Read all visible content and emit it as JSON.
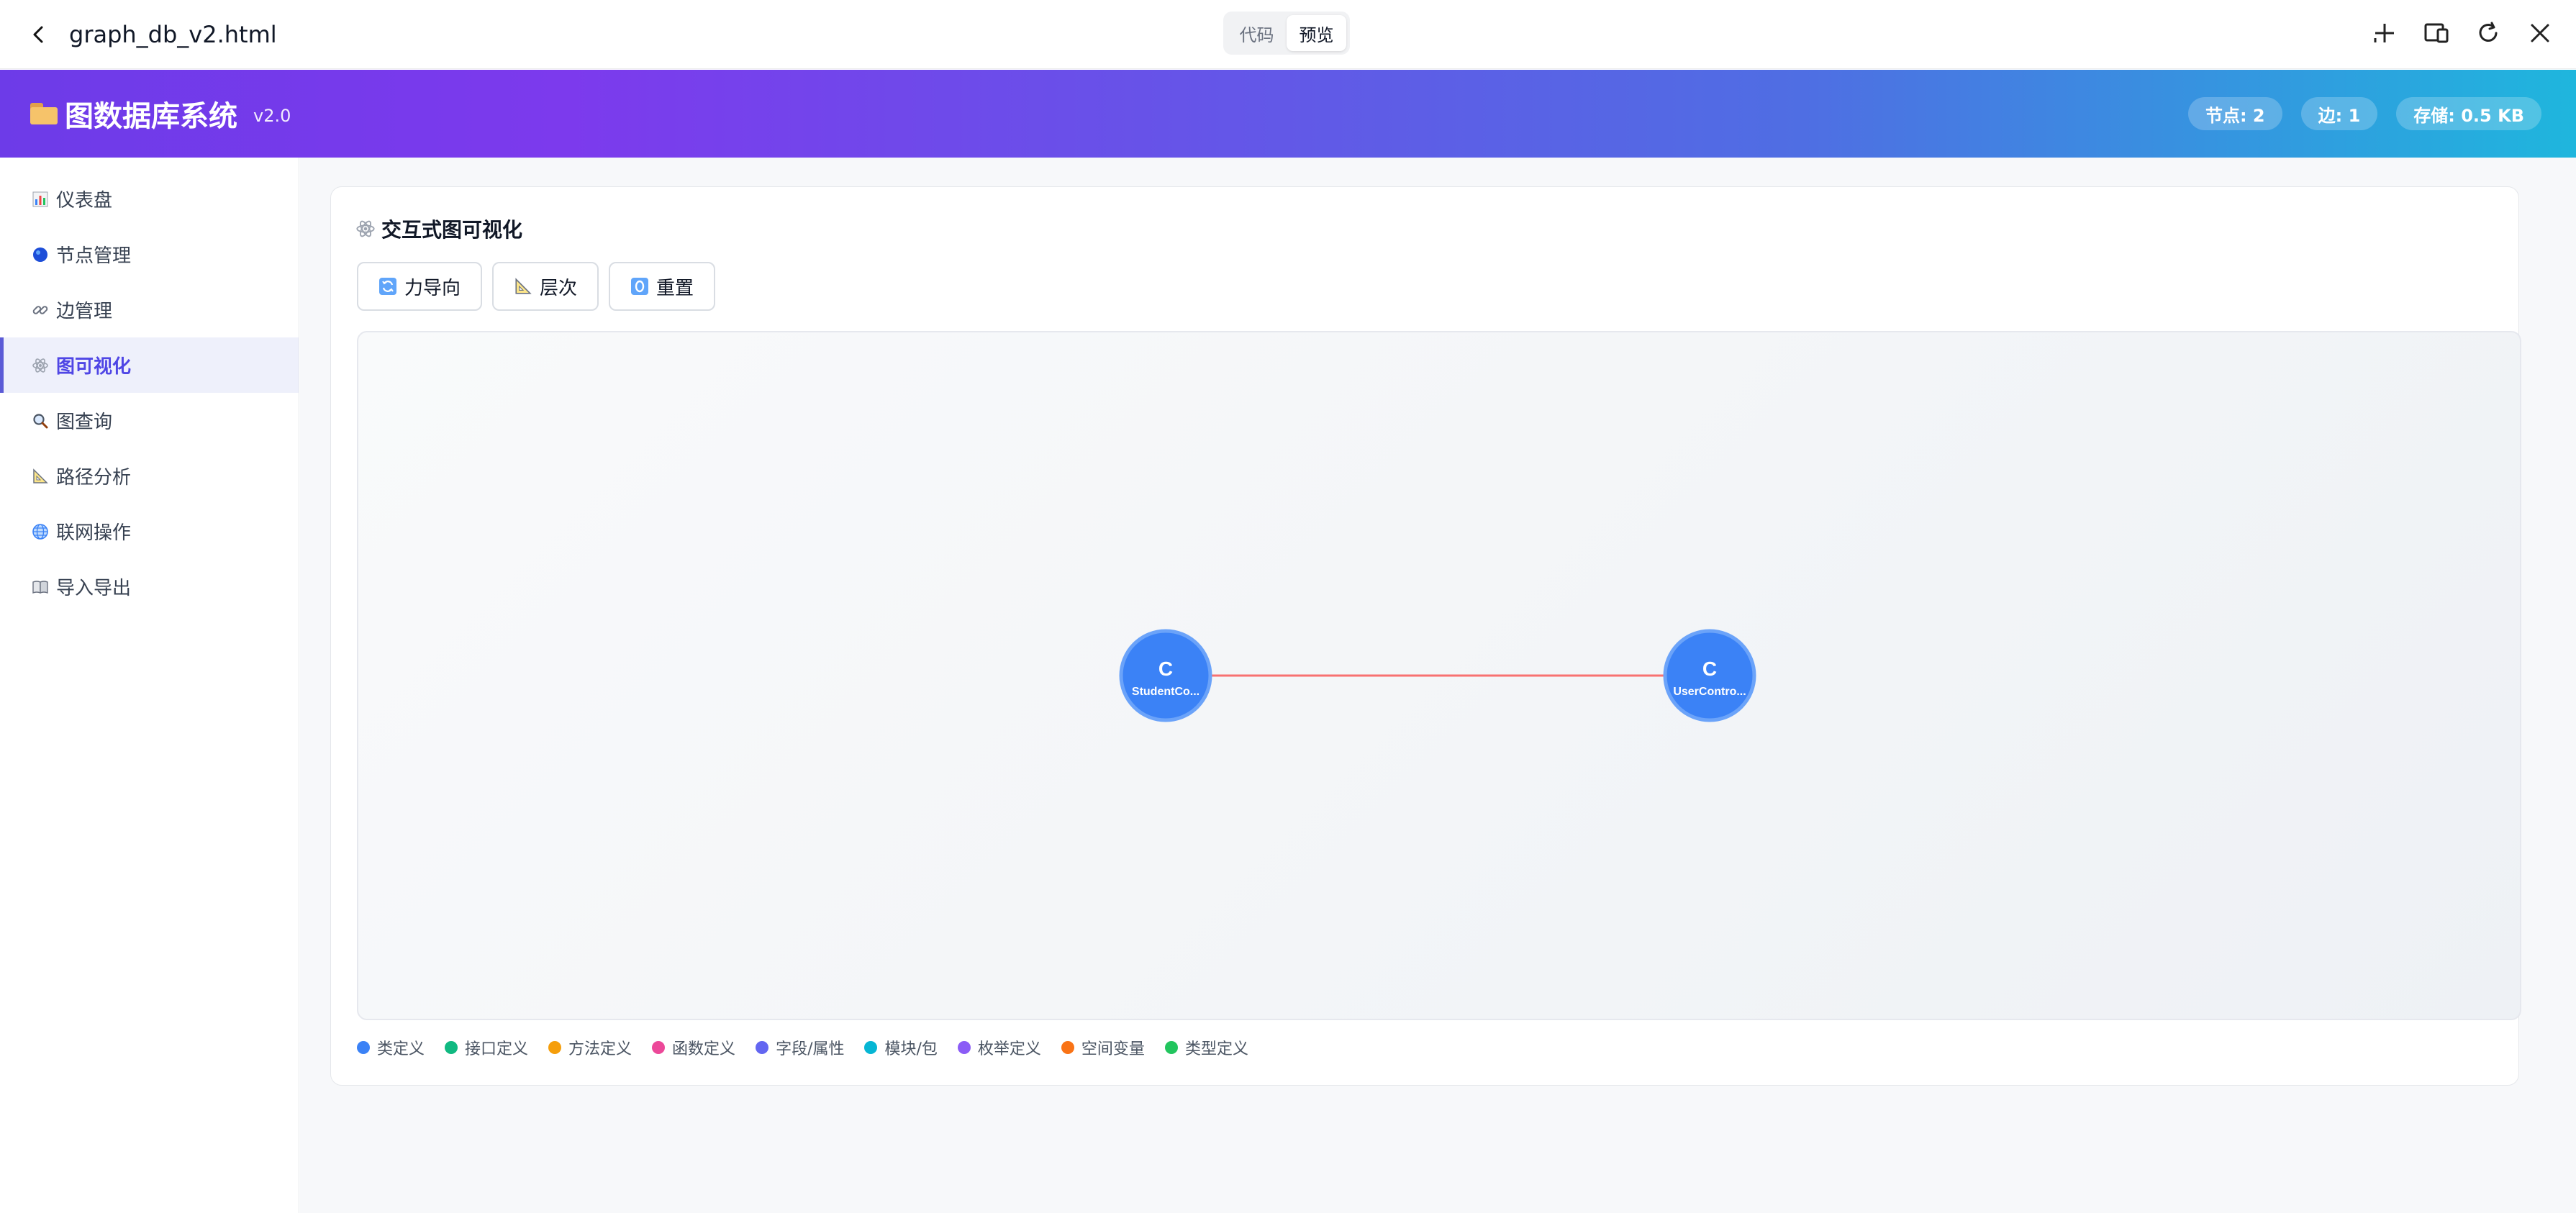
{
  "chrome": {
    "filename": "graph_db_v2.html",
    "tab_code": "代码",
    "tab_preview": "预览"
  },
  "header": {
    "title": "图数据库系统",
    "version": "v2.0",
    "stats": {
      "nodes": "节点: 2",
      "edges": "边: 1",
      "storage": "存储: 0.5 KB"
    }
  },
  "sidebar": {
    "items": [
      {
        "label": "仪表盘",
        "icon": "bar-chart-icon"
      },
      {
        "label": "节点管理",
        "icon": "blue-circle-icon"
      },
      {
        "label": "边管理",
        "icon": "link-icon"
      },
      {
        "label": "图可视化",
        "icon": "atom-icon",
        "active": true
      },
      {
        "label": "图查询",
        "icon": "magnifier-icon"
      },
      {
        "label": "路径分析",
        "icon": "triangle-ruler-icon"
      },
      {
        "label": "联网操作",
        "icon": "globe-icon"
      },
      {
        "label": "导入导出",
        "icon": "book-icon"
      }
    ]
  },
  "viz": {
    "title": "交互式图可视化",
    "buttons": {
      "force": "力导向",
      "hier": "层次",
      "reset": "重置"
    },
    "nodes": [
      {
        "letter": "C",
        "label": "StudentCo..."
      },
      {
        "letter": "C",
        "label": "UserContro..."
      }
    ],
    "colors": {
      "node": "#3b82f6",
      "node_stroke": "#5b9cf8",
      "edge": "#f87171"
    }
  },
  "legend": [
    {
      "label": "类定义",
      "color": "#3b82f6"
    },
    {
      "label": "接口定义",
      "color": "#10b981"
    },
    {
      "label": "方法定义",
      "color": "#f59e0b"
    },
    {
      "label": "函数定义",
      "color": "#ec4899"
    },
    {
      "label": "字段/属性",
      "color": "#6366f1"
    },
    {
      "label": "模块/包",
      "color": "#06b6d4"
    },
    {
      "label": "枚举定义",
      "color": "#8b5cf6"
    },
    {
      "label": "空间变量",
      "color": "#f97316"
    },
    {
      "label": "类型定义",
      "color": "#22c55e"
    }
  ]
}
